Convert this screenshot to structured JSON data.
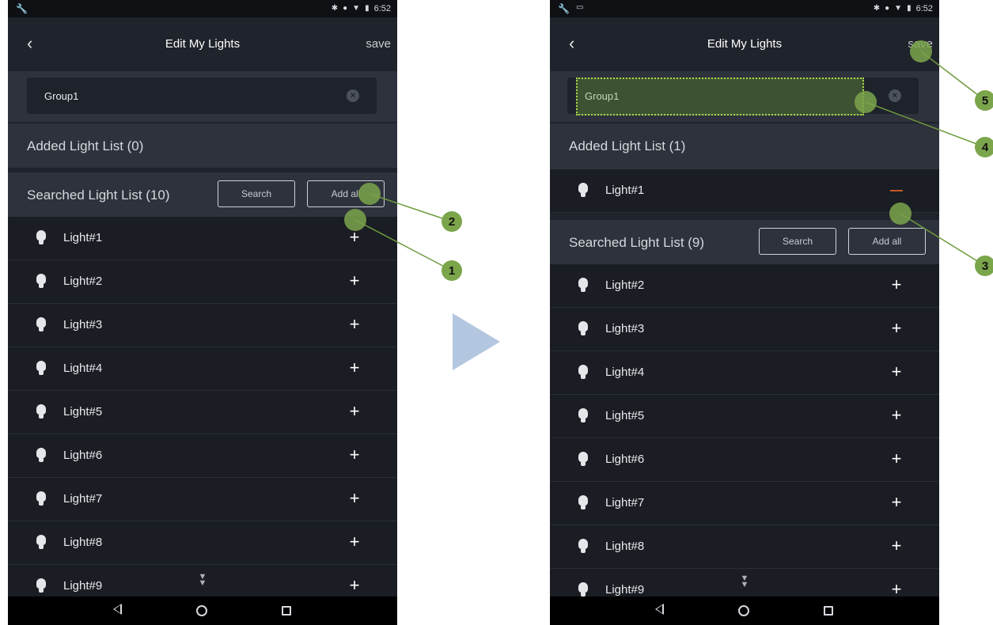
{
  "status_bar": {
    "time": "6:52"
  },
  "left": {
    "header": {
      "title": "Edit My Lights",
      "save_label": "save"
    },
    "group_name": "Group1",
    "added_header": "Added Light List (0)",
    "searched_header": "Searched Light List (10)",
    "search_label": "Search",
    "add_all_label": "Add all",
    "searched_lights": [
      "Light#1",
      "Light#2",
      "Light#3",
      "Light#4",
      "Light#5",
      "Light#6",
      "Light#7",
      "Light#8",
      "Light#9"
    ],
    "plus_symbol": "+"
  },
  "right": {
    "header": {
      "title": "Edit My Lights",
      "save_label": "save"
    },
    "group_name": "Group1",
    "added_header": "Added Light List (1)",
    "added_lights": [
      "Light#1"
    ],
    "searched_header": "Searched Light List (9)",
    "search_label": "Search",
    "add_all_label": "Add all",
    "searched_lights": [
      "Light#2",
      "Light#3",
      "Light#4",
      "Light#5",
      "Light#6",
      "Light#7",
      "Light#8",
      "Light#9"
    ],
    "plus_symbol": "+"
  },
  "annotations": {
    "step1": "1",
    "step2": "2",
    "step3": "3",
    "step4": "4",
    "step5": "5"
  },
  "colors": {
    "annotation_green": "#7ba54b",
    "annotation_line": "#6f9a3f",
    "flow_arrow": "#b3c7e0",
    "app_background": "#1f232b",
    "section_background": "#2d323c"
  }
}
